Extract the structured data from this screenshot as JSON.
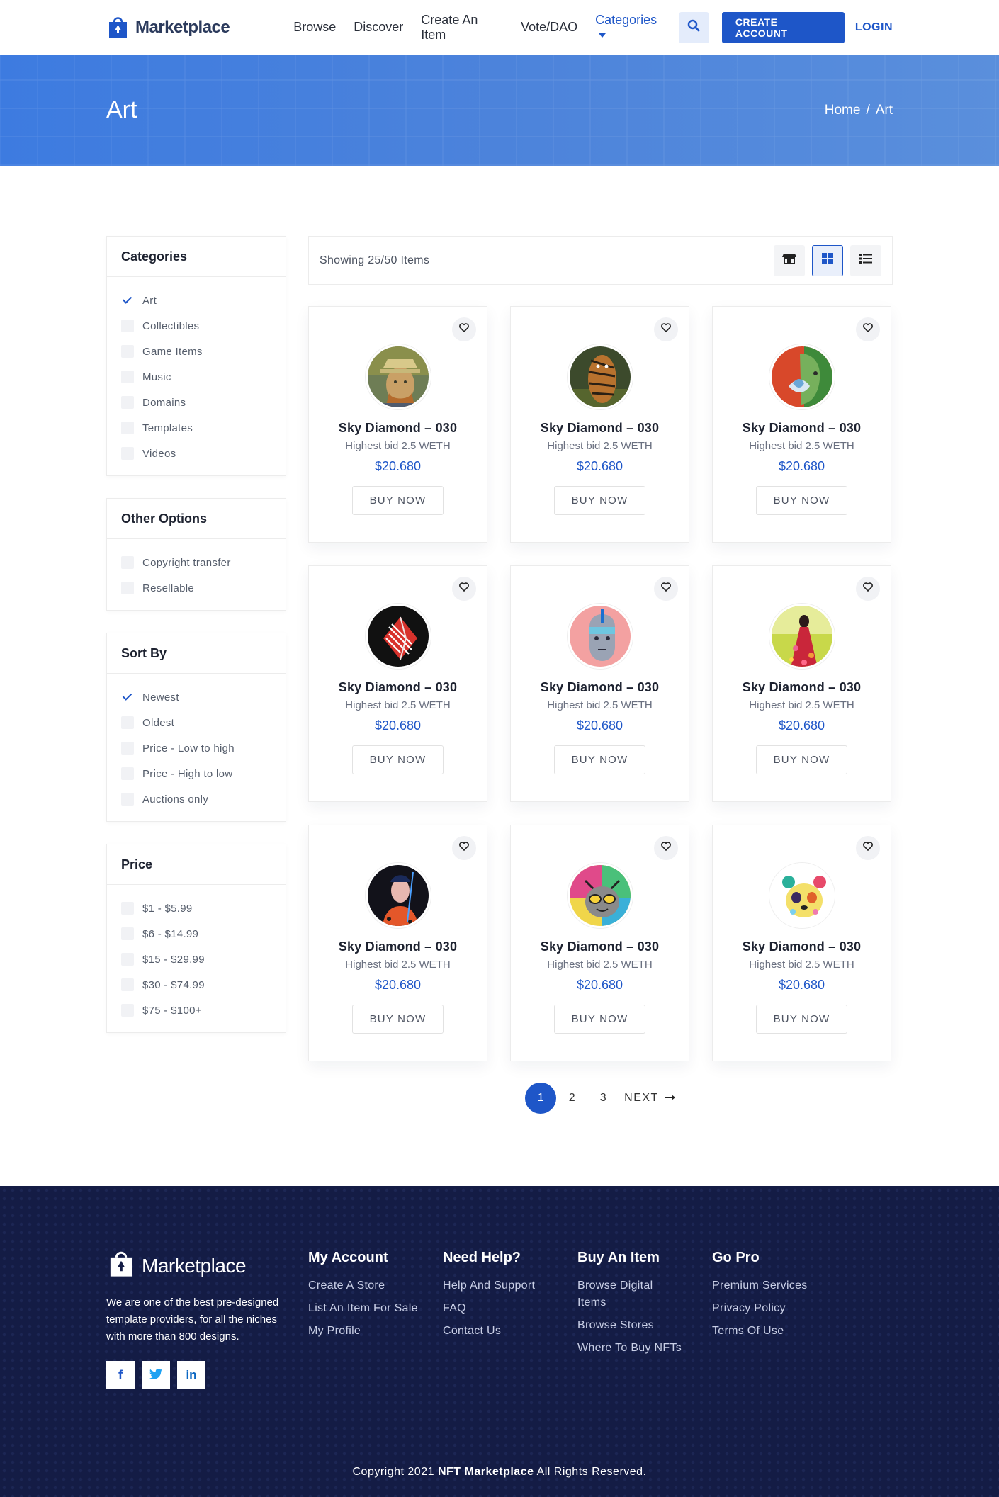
{
  "header": {
    "logo_text": "Marketplace",
    "nav": [
      "Browse",
      "Discover",
      "Create An Item",
      "Vote/DAO",
      "Categories"
    ],
    "create_account": "CREATE ACCOUNT",
    "login": "LOGIN",
    "accent_color": "#1e56c8"
  },
  "banner": {
    "title": "Art",
    "breadcrumb_home": "Home",
    "breadcrumb_sep": "/",
    "breadcrumb_current": "Art"
  },
  "sidebar": {
    "categories": {
      "title": "Categories",
      "items": [
        {
          "label": "Art",
          "checked": true
        },
        {
          "label": "Collectibles",
          "checked": false
        },
        {
          "label": "Game Items",
          "checked": false
        },
        {
          "label": "Music",
          "checked": false
        },
        {
          "label": "Domains",
          "checked": false
        },
        {
          "label": "Templates",
          "checked": false
        },
        {
          "label": "Videos",
          "checked": false
        }
      ]
    },
    "other": {
      "title": "Other Options",
      "items": [
        {
          "label": "Copyright transfer",
          "checked": false
        },
        {
          "label": "Resellable",
          "checked": false
        }
      ]
    },
    "sort": {
      "title": "Sort By",
      "items": [
        {
          "label": "Newest",
          "checked": true
        },
        {
          "label": "Oldest",
          "checked": false
        },
        {
          "label": "Price - Low to high",
          "checked": false
        },
        {
          "label": "Price - High to low",
          "checked": false
        },
        {
          "label": "Auctions only",
          "checked": false
        }
      ]
    },
    "price": {
      "title": "Price",
      "items": [
        {
          "label": "$1 - $5.99",
          "checked": false
        },
        {
          "label": "$6 - $14.99",
          "checked": false
        },
        {
          "label": "$15 - $29.99",
          "checked": false
        },
        {
          "label": "$30 - $74.99",
          "checked": false
        },
        {
          "label": "$75 - $100+",
          "checked": false
        }
      ]
    }
  },
  "toolbar": {
    "count_text": "Showing 25/50 Items"
  },
  "cards": [
    {
      "title": "Sky Diamond – 030",
      "bid": "Highest bid 2.5 WETH",
      "price": "$20.680",
      "buy": "BUY NOW",
      "art": "portrait"
    },
    {
      "title": "Sky Diamond – 030",
      "bid": "Highest bid 2.5 WETH",
      "price": "$20.680",
      "buy": "BUY NOW",
      "art": "tiger"
    },
    {
      "title": "Sky Diamond – 030",
      "bid": "Highest bid 2.5 WETH",
      "price": "$20.680",
      "buy": "BUY NOW",
      "art": "buddha"
    },
    {
      "title": "Sky Diamond – 030",
      "bid": "Highest bid 2.5 WETH",
      "price": "$20.680",
      "buy": "BUY NOW",
      "art": "abstract"
    },
    {
      "title": "Sky Diamond – 030",
      "bid": "Highest bid 2.5 WETH",
      "price": "$20.680",
      "buy": "BUY NOW",
      "art": "robot-head"
    },
    {
      "title": "Sky Diamond – 030",
      "bid": "Highest bid 2.5 WETH",
      "price": "$20.680",
      "buy": "BUY NOW",
      "art": "flower-woman"
    },
    {
      "title": "Sky Diamond – 030",
      "bid": "Highest bid 2.5 WETH",
      "price": "$20.680",
      "buy": "BUY NOW",
      "art": "man-suit"
    },
    {
      "title": "Sky Diamond – 030",
      "bid": "Highest bid 2.5 WETH",
      "price": "$20.680",
      "buy": "BUY NOW",
      "art": "cat"
    },
    {
      "title": "Sky Diamond – 030",
      "bid": "Highest bid 2.5 WETH",
      "price": "$20.680",
      "buy": "BUY NOW",
      "art": "panda"
    }
  ],
  "pagination": {
    "pages": [
      "1",
      "2",
      "3"
    ],
    "current": "1",
    "next": "NEXT"
  },
  "footer": {
    "logo_text": "Marketplace",
    "description": "We are one of the best pre-designed template providers, for all the niches with more than 800 designs.",
    "social": [
      "f",
      "t",
      "in"
    ],
    "columns": [
      {
        "title": "My Account",
        "links": [
          "Create A Store",
          "List An Item For Sale",
          "My Profile"
        ]
      },
      {
        "title": "Need Help?",
        "links": [
          "Help And Support",
          "FAQ",
          "Contact Us"
        ]
      },
      {
        "title": "Buy An Item",
        "links": [
          "Browse Digital Items",
          "Browse Stores",
          "Where To Buy NFTs"
        ]
      },
      {
        "title": "Go Pro",
        "links": [
          "Premium Services",
          "Privacy Policy",
          "Terms Of Use"
        ]
      }
    ],
    "copyright_pre": "Copyright 2021",
    "copyright_brand": "NFT Marketplace",
    "copyright_post": "All Rights Reserved."
  }
}
